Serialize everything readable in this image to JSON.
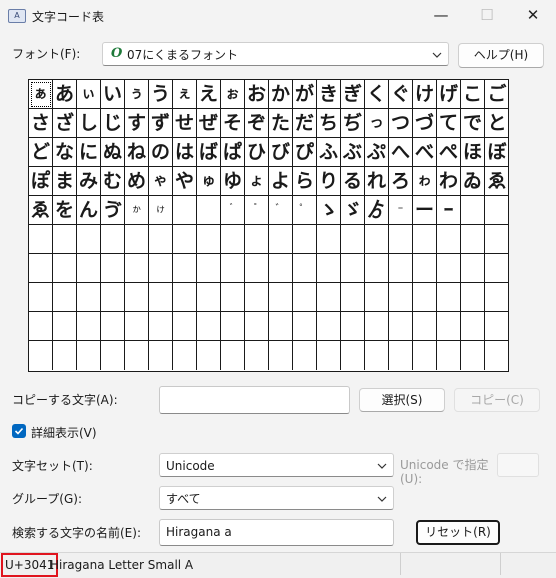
{
  "window": {
    "title": "文字コード表",
    "icon_text": "A",
    "minimize": "—",
    "maximize": "☐",
    "close": "✕"
  },
  "font": {
    "label": "フォント(F):",
    "icon": "O",
    "value": "07にくまるフォント",
    "help_label": "ヘルプ(H)"
  },
  "grid": {
    "selected_index": 0,
    "chars": [
      "ぁ",
      "あ",
      "ぃ",
      "い",
      "ぅ",
      "う",
      "ぇ",
      "え",
      "ぉ",
      "お",
      "か",
      "が",
      "き",
      "ぎ",
      "く",
      "ぐ",
      "け",
      "げ",
      "こ",
      "ご",
      "さ",
      "ざ",
      "し",
      "じ",
      "す",
      "ず",
      "せ",
      "ぜ",
      "そ",
      "ぞ",
      "た",
      "だ",
      "ち",
      "ぢ",
      "っ",
      "つ",
      "づ",
      "て",
      "で",
      "と",
      "ど",
      "な",
      "に",
      "ぬ",
      "ね",
      "の",
      "は",
      "ば",
      "ぱ",
      "ひ",
      "び",
      "ぴ",
      "ふ",
      "ぶ",
      "ぷ",
      "へ",
      "べ",
      "ぺ",
      "ほ",
      "ぼ",
      "ぽ",
      "ま",
      "み",
      "む",
      "め",
      "ゃ",
      "や",
      "ゅ",
      "ゆ",
      "ょ",
      "よ",
      "ら",
      "り",
      "る",
      "れ",
      "ろ",
      "ゎ",
      "わ",
      "ゐ",
      "ゑ",
      "ゑ",
      "を",
      "ん",
      "ゔ",
      "ゕ",
      "ゖ",
      "",
      "",
      "゙",
      "゚",
      "゛",
      "゜",
      "ゝ",
      "ゞ",
      "ゟ",
      "゠",
      "ー",
      "ｰ",
      "",
      ""
    ],
    "small_chars": [
      "ぁ",
      "ぃ",
      "ぅ",
      "ぇ",
      "ぉ",
      "っ",
      "ゃ",
      "ゅ",
      "ょ",
      "ゎ"
    ],
    "tiny_chars": [
      "ゕ",
      "ゖ",
      "゙",
      "゚",
      "゛",
      "゜",
      "゠"
    ]
  },
  "copy": {
    "label": "コピーする文字(A):",
    "value": "",
    "select_label": "選択(S)",
    "copy_label": "コピー(C)"
  },
  "advanced": {
    "label": "詳細表示(V)",
    "checked": true
  },
  "charset": {
    "label": "文字セット(T):",
    "value": "Unicode",
    "unicode_label_1": "Unicode で指定",
    "unicode_label_2": "(U):",
    "unicode_value": ""
  },
  "group": {
    "label": "グループ(G):",
    "value": "すべて"
  },
  "search": {
    "label": "検索する文字の名前(E):",
    "value": "Hiragana a",
    "reset_label": "リセット(R)"
  },
  "status": {
    "code": "U+3041",
    "name": "Hiragana Letter Small A"
  },
  "colors": {
    "accent": "#0067c0",
    "highlight_border": "#e0141e",
    "font_icon": "#1f7a3a"
  }
}
